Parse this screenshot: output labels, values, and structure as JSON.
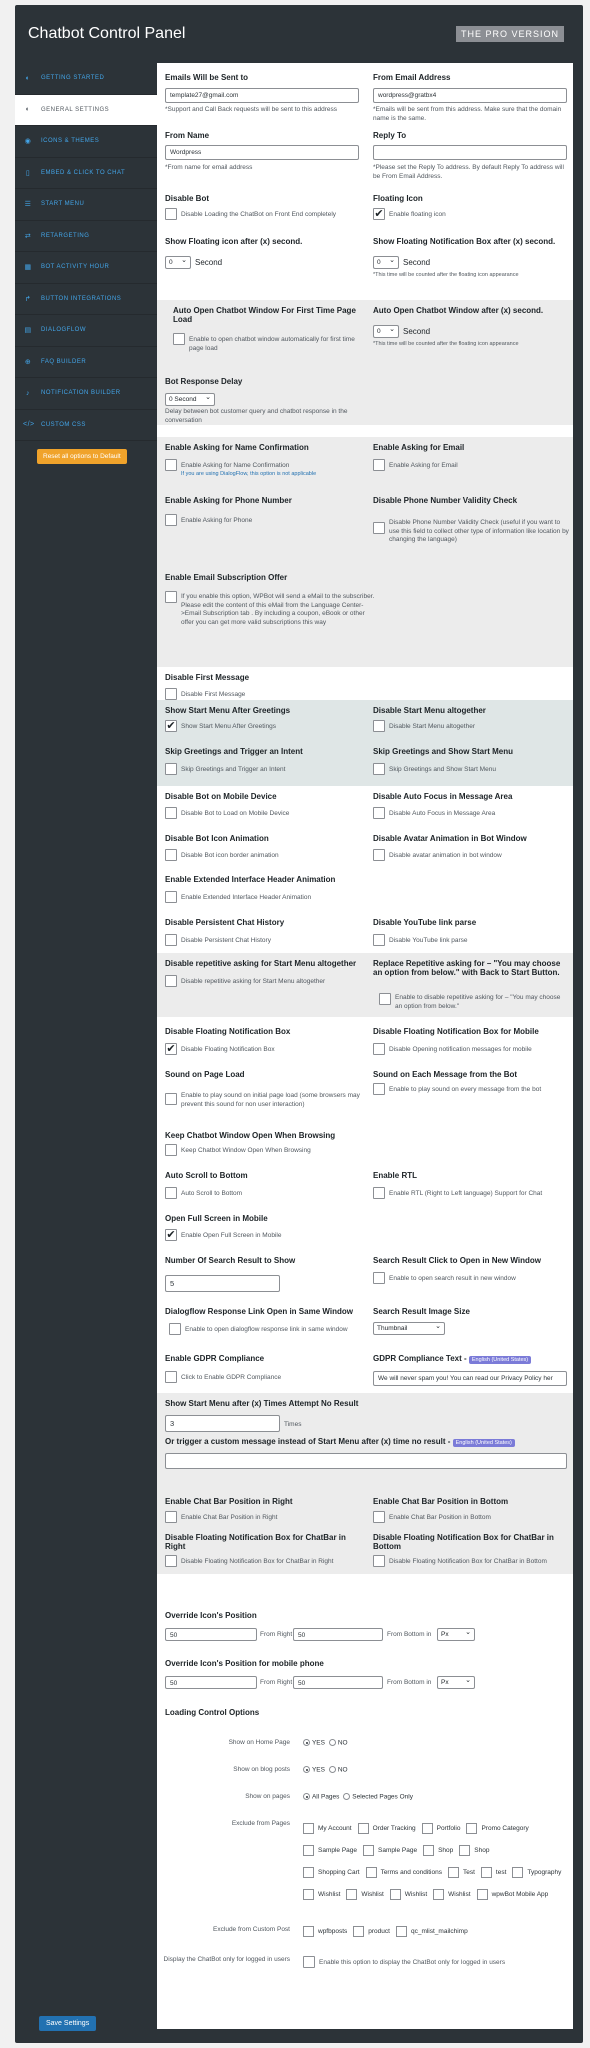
{
  "header": {
    "title": "Chatbot Control Panel",
    "pro_label": "THE PRO VERSION"
  },
  "sidebar": {
    "items": [
      {
        "label": "GETTING STARTED",
        "icon": "toggle-icon"
      },
      {
        "label": "GENERAL SETTINGS",
        "icon": "toggle-icon"
      },
      {
        "label": "ICONS & THEMES",
        "icon": "palette-icon"
      },
      {
        "label": "EMBED & CLICK TO CHAT",
        "icon": "phone-icon"
      },
      {
        "label": "START MENU",
        "icon": "menu-icon"
      },
      {
        "label": "RETARGETING",
        "icon": "retarget-icon"
      },
      {
        "label": "BOT ACTIVITY HOUR",
        "icon": "calendar-icon"
      },
      {
        "label": "BUTTON INTEGRATIONS",
        "icon": "share-icon"
      },
      {
        "label": "DIALOGFLOW",
        "icon": "chat-icon"
      },
      {
        "label": "FAQ BUILDER",
        "icon": "globe-icon"
      },
      {
        "label": "NOTIFICATION BUILDER",
        "icon": "bell-icon"
      },
      {
        "label": "CUSTOM CSS",
        "icon": "code-icon"
      }
    ],
    "reset_button": "Reset all options to Default"
  },
  "form": {
    "emails_to": {
      "label": "Emails Will be Sent to",
      "value": "template27@gmail.com",
      "hint": "*Support and Call Back requests will be sent to this address"
    },
    "from_email": {
      "label": "From Email Address",
      "value": "wordpress@gratbx4",
      "hint": "*Emails will be sent from this address. Make sure that the domain name is the same."
    },
    "from_name": {
      "label": "From Name",
      "value": "Wordpress",
      "hint": "*From name for email address"
    },
    "reply_to": {
      "label": "Reply To",
      "value": "",
      "hint": "*Please set the Reply To address. By default Reply To address will be From Email Address."
    },
    "disable_bot": {
      "label": "Disable Bot",
      "cb": "Disable Loading the ChatBot on Front End completely"
    },
    "floating_icon": {
      "label": "Floating Icon",
      "cb": "Enable floating icon"
    },
    "show_floating": {
      "label": "Show Floating icon after (x) second.",
      "value": "0",
      "unit": "Second"
    },
    "show_notif": {
      "label": "Show Floating Notification Box after (x) second.",
      "value": "0",
      "unit": "Second",
      "hint": "*This time will be counted after the floating icon appearance"
    },
    "auto_open_first": {
      "label": "Auto Open Chatbot Window For First Time Page Load",
      "cb": "Enable to open chatbot window automatically for first time page load"
    },
    "auto_open_after": {
      "label": "Auto Open Chatbot Window after (x) second.",
      "value": "0",
      "unit": "Second",
      "hint": "*This time will be counted after the floating icon appearance"
    },
    "response_delay": {
      "label": "Bot Response Delay",
      "value": "0 Second",
      "hint": "Delay between bot customer query and chatbot response in the conversation"
    },
    "ask_name": {
      "label": "Enable Asking for Name Confirmation",
      "cb": "Enable Asking for Name Confirmation",
      "note": "If you are using DialogFlow, this option is not applicable"
    },
    "ask_email": {
      "label": "Enable Asking for Email",
      "cb": "Enable Asking for Email"
    },
    "ask_phone": {
      "label": "Enable Asking for Phone Number",
      "cb": "Enable Asking for Phone"
    },
    "phone_validity": {
      "label": "Disable Phone Number Validity Check",
      "cb": "Disable Phone Number Validity Check (useful if you want to use this field to collect other type of information like location by changing the language)"
    },
    "email_sub": {
      "label": "Enable Email Subscription Offer",
      "cb": "If you enable this option, WPBot will send a eMail to the subscriber. Please edit the content of this eMail from the Language Center->Email Subscription tab . By including a coupon, eBook or other offer you can get more valid subscriptions this way"
    },
    "first_msg": {
      "label": "Disable First Message",
      "cb": "Disable First Message"
    },
    "start_after_greet": {
      "label": "Show Start Menu After Greetings",
      "cb": "Show Start Menu After Greetings"
    },
    "disable_start": {
      "label": "Disable Start Menu altogether",
      "cb": "Disable Start Menu altogether"
    },
    "skip_greet_intent": {
      "label": "Skip Greetings and Trigger an Intent",
      "cb": "Skip Greetings and Trigger an Intent"
    },
    "skip_greet_menu": {
      "label": "Skip Greetings and Show Start Menu",
      "cb": "Skip Greetings and Show Start Menu"
    },
    "mobile": {
      "label": "Disable Bot on Mobile Device",
      "cb": "Disable Bot to Load on Mobile Device"
    },
    "autofocus": {
      "label": "Disable Auto Focus in Message Area",
      "cb": "Disable Auto Focus in Message Area"
    },
    "icon_anim": {
      "label": "Disable Bot Icon Animation",
      "cb": "Disable Bot icon border animation"
    },
    "avatar_anim": {
      "label": "Disable Avatar Animation in Bot Window",
      "cb": "Disable avatar animation in bot window"
    },
    "header_anim": {
      "label": "Enable Extended Interface Header Animation",
      "cb": "Enable Extended Interface Header Animation"
    },
    "persist": {
      "label": "Disable Persistent Chat History",
      "cb": "Disable Persistent Chat History"
    },
    "youtube": {
      "label": "Disable YouTube link parse",
      "cb": "Disable YouTube link parse"
    },
    "repetitive": {
      "label": "Disable repetitive asking for Start Menu altogether",
      "cb": "Disable repetitive asking for Start Menu altogether"
    },
    "replace_rep": {
      "label": "Replace Repetitive asking for – \"You may choose an option from below.\" with Back to Start Button.",
      "cb": "Enable to disable repetitive asking for – \"You may choose an option from below.\""
    },
    "float_notif": {
      "label": "Disable Floating Notification Box",
      "cb": "Disable Floating Notification Box"
    },
    "float_notif_mobile": {
      "label": "Disable Floating Notification Box for Mobile",
      "cb": "Disable Opening notification messages for mobile"
    },
    "sound_load": {
      "label": "Sound on Page Load",
      "cb": "Enable to play sound on initial page load (some browsers may prevent this sound for non user interaction)"
    },
    "sound_msg": {
      "label": "Sound on Each Message from the Bot",
      "cb": "Enable to play sound on every message from the bot"
    },
    "keep_open": {
      "label": "Keep Chatbot Window Open When Browsing",
      "cb": "Keep Chatbot Window Open When Browsing"
    },
    "auto_scroll": {
      "label": "Auto Scroll to Bottom",
      "cb": "Auto Scroll to Bottom"
    },
    "rtl": {
      "label": "Enable RTL",
      "cb": "Enable RTL (Right to Left language) Support for Chat"
    },
    "fullscreen": {
      "label": "Open Full Screen in Mobile",
      "cb": "Enable Open Full Screen in Mobile"
    },
    "search_count": {
      "label": "Number Of Search Result to Show",
      "value": "5"
    },
    "search_new": {
      "label": "Search Result Click to Open in New Window",
      "cb": "Enable to open search result in new window"
    },
    "df_link": {
      "label": "Dialogflow Response Link Open in Same Window",
      "cb": "Enable to open dialogflow response link in same window"
    },
    "img_size": {
      "label": "Search Result Image Size",
      "value": "Thumbnail"
    },
    "gdpr": {
      "label": "Enable GDPR Compliance",
      "cb": "Click to Enable GDPR Compliance"
    },
    "gdpr_text": {
      "label": "GDPR Compliance Text -",
      "badge": "English (United States)",
      "value": "We will never spam you! You can read our Privacy Policy her"
    },
    "start_after_x": {
      "label": "Show Start Menu after (x) Times Attempt No Result",
      "value": "3",
      "unit": "Times"
    },
    "custom_msg": {
      "label": "Or trigger a custom message instead of Start Menu after (x) time no result -",
      "badge": "English (United States)",
      "value": ""
    },
    "chatbar_right": {
      "label": "Enable Chat Bar Position in Right",
      "cb": "Enable Chat Bar Position in Right"
    },
    "chatbar_bottom": {
      "label": "Enable Chat Bar Position in Bottom",
      "cb": "Enable Chat Bar Position in Bottom"
    },
    "notif_right": {
      "label": "Disable Floating Notification Box for ChatBar in Right",
      "cb": "Disable Floating Notification Box for ChatBar in Right"
    },
    "notif_bottom": {
      "label": "Disable Floating Notification Box for ChatBar in Bottom",
      "cb": "Disable Floating Notification Box for ChatBar in Bottom"
    },
    "override_pos": {
      "label": "Override Icon's Position",
      "right": "50",
      "right_label": "From Right",
      "bottom": "50",
      "bottom_label": "From Bottom in",
      "unit": "Px"
    },
    "override_mobile": {
      "label": "Override Icon's Position for mobile phone",
      "right": "50",
      "right_label": "From Right",
      "bottom": "50",
      "bottom_label": "From Bottom in",
      "unit": "Px"
    },
    "loading": {
      "label": "Loading Control Options",
      "home": {
        "label": "Show on Home Page",
        "yes": "YES",
        "no": "NO"
      },
      "blog": {
        "label": "Show on blog posts",
        "yes": "YES",
        "no": "NO"
      },
      "pages": {
        "label": "Show on pages",
        "all": "All Pages",
        "selected": "Selected Pages Only"
      },
      "exclude_pages_label": "Exclude from Pages",
      "exclude_pages": [
        "My Account",
        "Order Tracking",
        "Portfolio",
        "Promo Category",
        "Sample Page",
        "Sample Page",
        "Shop",
        "Shop",
        "Shopping Cart",
        "Terms and conditions",
        "Test",
        "test",
        "Typography",
        "Wishlist",
        "Wishlist",
        "Wishlist",
        "Wishlist",
        "wpwBot Mobile App"
      ],
      "exclude_post_label": "Exclude from Custom Post",
      "exclude_posts": [
        "wpfbposts",
        "product",
        "qc_mlist_mailchimp"
      ],
      "logged_label": "Display the ChatBot only for logged in users",
      "logged_cb": "Enable this option to display the ChatBot only for logged in users"
    },
    "save": "Save Settings"
  }
}
